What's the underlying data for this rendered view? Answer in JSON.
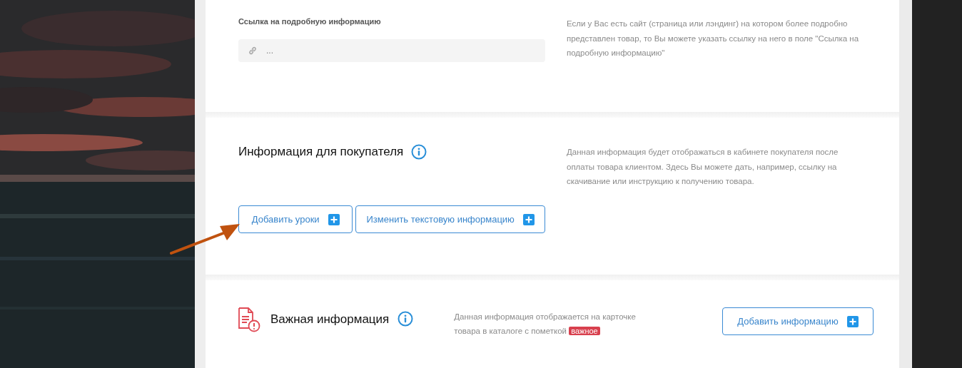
{
  "link_section": {
    "label": "Ссылка на подробную информацию",
    "field": {
      "placeholder": "..."
    },
    "hint": "Если у Вас есть сайт (страница или лэндинг) на котором более подробно представлен товар, то Вы можете указать ссылку на него в поле \"Ссылка на подробную информацию\""
  },
  "buyer_section": {
    "title": "Информация для покупателя",
    "hint": "Данная информация будет отображаться в кабинете покупателя после оплаты товара клиентом. Здесь Вы можете дать, например, ссылку на скачивание или инструкцию к получению товара.",
    "buttons": [
      "Добавить уроки",
      "Изменить текстовую информацию"
    ]
  },
  "important_section": {
    "title": "Важная информация",
    "hint": "Данная информация отображается на карточке товара в каталоге с пометкой",
    "tag": "важное",
    "button": "Добавить информацию"
  }
}
